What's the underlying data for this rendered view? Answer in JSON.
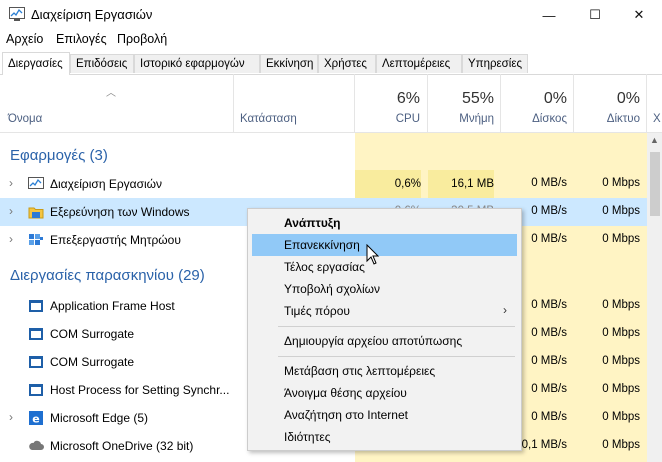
{
  "window": {
    "title": "Διαχείριση Εργασιών",
    "minimize": "—",
    "maximize": "☐",
    "close": "✕"
  },
  "menu": [
    "Αρχείο",
    "Επιλογές",
    "Προβολή"
  ],
  "tabs": [
    "Διεργασίες",
    "Επιδόσεις",
    "Ιστορικό εφαρμογών",
    "Εκκίνηση",
    "Χρήστες",
    "Λεπτομέρειες",
    "Υπηρεσίες"
  ],
  "header": {
    "name": "Όνομα",
    "status": "Κατάσταση",
    "cpu_pct": "6%",
    "cpu": "CPU",
    "mem_pct": "55%",
    "mem": "Μνήμη",
    "disk_pct": "0%",
    "disk": "Δίσκος",
    "net_pct": "0%",
    "net": "Δίκτυο",
    "extra": "Χ"
  },
  "groups": {
    "apps": "Εφαρμογές (3)",
    "background": "Διεργασίες παρασκηνίου (29)"
  },
  "apps": [
    {
      "name": "Διαχείριση Εργασιών",
      "cpu": "0,6%",
      "mem": "16,1 MB",
      "disk": "0 MB/s",
      "net": "0 Mbps",
      "icon": "task-manager-icon"
    },
    {
      "name": "Εξερεύνηση των Windows",
      "cpu": "0,6%",
      "mem": "30,5 MB",
      "disk": "0 MB/s",
      "net": "0 Mbps",
      "icon": "folder-icon"
    },
    {
      "name": "Επεξεργαστής Μητρώου",
      "cpu": "",
      "mem": "",
      "disk": "0 MB/s",
      "net": "0 Mbps",
      "icon": "registry-icon"
    }
  ],
  "background": [
    {
      "name": "Application Frame Host",
      "disk": "0 MB/s",
      "net": "0 Mbps",
      "icon": "app-window-icon"
    },
    {
      "name": "COM Surrogate",
      "disk": "0 MB/s",
      "net": "0 Mbps",
      "icon": "app-window-icon"
    },
    {
      "name": "COM Surrogate",
      "disk": "0 MB/s",
      "net": "0 Mbps",
      "icon": "app-window-icon"
    },
    {
      "name": "Host Process for Setting Synchr...",
      "disk": "0 MB/s",
      "net": "0 Mbps",
      "icon": "app-window-icon"
    },
    {
      "name": "Microsoft Edge (5)",
      "disk": "0 MB/s",
      "net": "0 Mbps",
      "icon": "edge-icon"
    },
    {
      "name": "Microsoft OneDrive (32 bit)",
      "disk": "0,1 MB/s",
      "net": "0 Mbps",
      "icon": "cloud-icon"
    }
  ],
  "context_menu": [
    "Ανάπτυξη",
    "Επανεκκίνηση",
    "Τέλος εργασίας",
    "Υποβολή σχολίων",
    "Τιμές πόρου",
    "Δημιουργία αρχείου αποτύπωσης",
    "Μετάβαση στις λεπτομέρειες",
    "Άνοιγμα θέσης αρχείου",
    "Αναζήτηση στο Internet",
    "Ιδιότητες"
  ],
  "colors": {
    "group_text": "#2a62a9",
    "highlight": "#91c9f7",
    "selected_row": "#cce8ff",
    "resource_tint": "#fff4c4"
  }
}
